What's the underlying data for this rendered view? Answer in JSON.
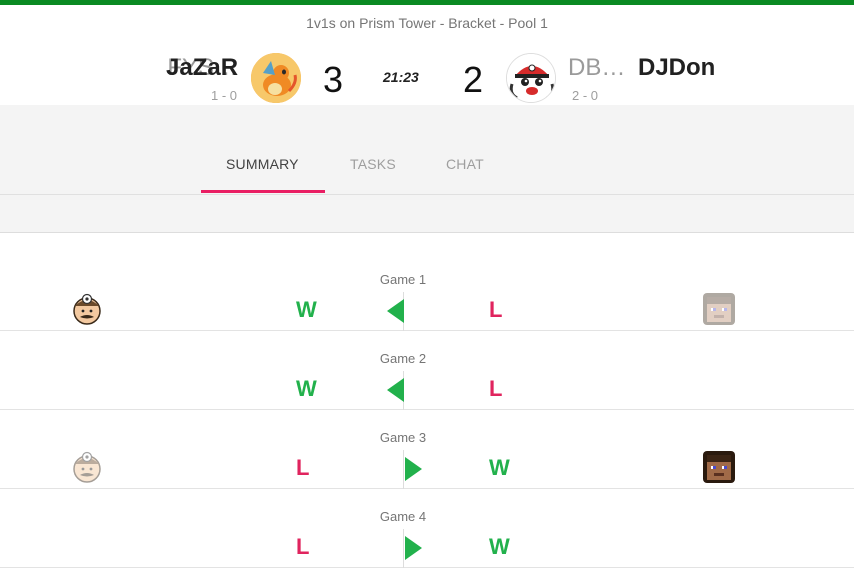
{
  "header": {
    "event_title": "1v1s on Prism Tower - Bracket - Pool 1",
    "clock": "21:23",
    "left": {
      "team": "FYS…",
      "name": "JaZaR",
      "record": "1 - 0",
      "score": "3",
      "avatar": "charizard-avatar"
    },
    "right": {
      "team": "DB…",
      "name": "DJDon",
      "record": "2 - 0",
      "score": "2",
      "avatar": "pokeball-mascot-avatar"
    }
  },
  "tabs": [
    {
      "label": "SUMMARY",
      "active": true
    },
    {
      "label": "TASKS",
      "active": false
    },
    {
      "label": "CHAT",
      "active": false
    }
  ],
  "colors": {
    "accent": "#e91e63",
    "win": "#22b14c",
    "loss": "#e0245e",
    "topbar": "#0a8a22"
  },
  "games": [
    {
      "label": "Game 1",
      "left_result": "W",
      "right_result": "L",
      "winner": "left",
      "left_character": "dr-mario-icon",
      "right_character": "steve-icon-faded"
    },
    {
      "label": "Game 2",
      "left_result": "W",
      "right_result": "L",
      "winner": "left",
      "left_character": "",
      "right_character": ""
    },
    {
      "label": "Game 3",
      "left_result": "L",
      "right_result": "W",
      "winner": "right",
      "left_character": "dr-mario-icon-faded",
      "right_character": "steve-icon"
    },
    {
      "label": "Game 4",
      "left_result": "L",
      "right_result": "W",
      "winner": "right",
      "left_character": "",
      "right_character": ""
    }
  ]
}
